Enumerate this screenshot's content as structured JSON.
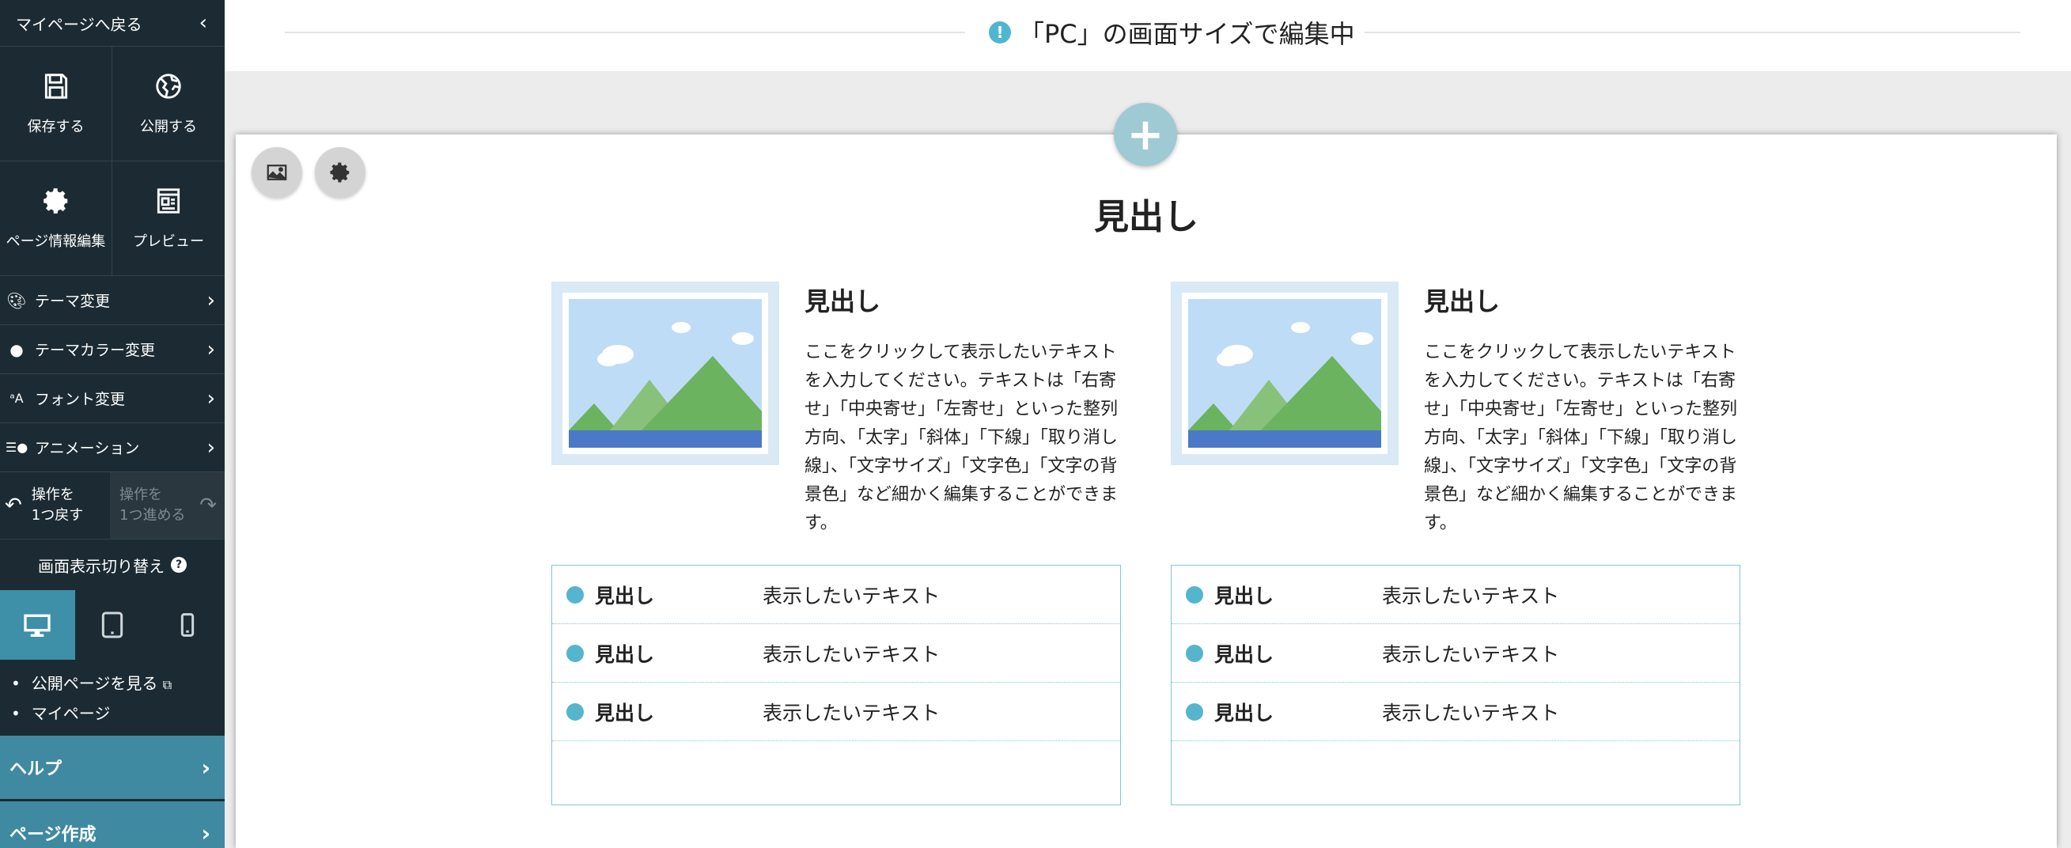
{
  "sidebar": {
    "back_label": "マイページへ戻る",
    "tools": [
      {
        "label": "保存する",
        "icon": "save-icon"
      },
      {
        "label": "公開する",
        "icon": "publish-icon"
      },
      {
        "label": "ページ情報編集",
        "icon": "gear-icon"
      },
      {
        "label": "プレビュー",
        "icon": "preview-icon"
      }
    ],
    "menu": [
      {
        "label": "テーマ変更",
        "icon": "palette-icon"
      },
      {
        "label": "テーマカラー変更",
        "icon": "color-palette-icon"
      },
      {
        "label": "フォント変更",
        "icon": "font-icon"
      },
      {
        "label": "アニメーション",
        "icon": "animation-icon"
      }
    ],
    "undo_label": "操作を\n1つ戻す",
    "redo_label": "操作を\n1つ進める",
    "view_switch_title": "画面表示切り替え",
    "devices": [
      "desktop",
      "tablet",
      "mobile"
    ],
    "active_device": "desktop",
    "links": [
      "公開ページを見る",
      "マイページ"
    ],
    "help_label": "ヘルプ",
    "page_create_label": "ページ作成"
  },
  "notice": {
    "text": "「PC」の画面サイズで編集中"
  },
  "canvas": {
    "section_title": "見出し",
    "cards": [
      {
        "heading": "見出し",
        "body": "ここをクリックして表示したいテキストを入力してください。テキストは「右寄せ」「中央寄せ」「左寄せ」といった整列方向、「太字」「斜体」「下線」「取り消し線」、「文字サイズ」「文字色」「文字の背景色」など細かく編集することができます。",
        "rows": [
          {
            "label": "見出し",
            "value": "表示したいテキスト"
          },
          {
            "label": "見出し",
            "value": "表示したいテキスト"
          },
          {
            "label": "見出し",
            "value": "表示したいテキスト"
          }
        ]
      },
      {
        "heading": "見出し",
        "body": "ここをクリックして表示したいテキストを入力してください。テキストは「右寄せ」「中央寄せ」「左寄せ」といった整列方向、「太字」「斜体」「下線」「取り消し線」、「文字サイズ」「文字色」「文字の背景色」など細かく編集することができます。",
        "rows": [
          {
            "label": "見出し",
            "value": "表示したいテキスト"
          },
          {
            "label": "見出し",
            "value": "表示したいテキスト"
          },
          {
            "label": "見出し",
            "value": "表示したいテキスト"
          }
        ]
      }
    ]
  },
  "colors": {
    "sidebar_bg": "#1c2b33",
    "accent": "#3f8aa0",
    "table_border": "#7fc7d6",
    "bullet": "#54b5cc"
  }
}
